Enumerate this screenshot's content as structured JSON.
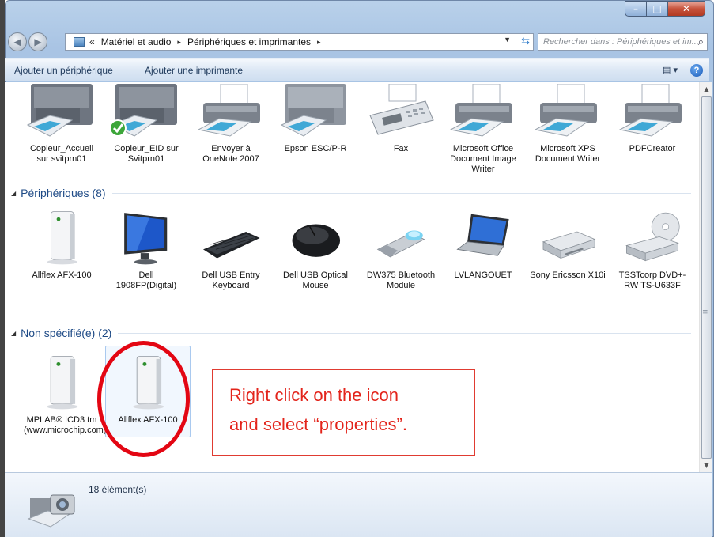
{
  "window": {
    "controls": {
      "minimize": "–",
      "maximize": "□",
      "close": "✕"
    }
  },
  "address_bar": {
    "prefix": "«",
    "breadcrumbs": [
      "Matériel et audio",
      "Périphériques et imprimantes"
    ],
    "separator": "▸",
    "search_placeholder": "Rechercher dans : Périphériques et im..."
  },
  "command_bar": {
    "add_device": "Ajouter un périphérique",
    "add_printer": "Ajouter une imprimante"
  },
  "printers_group": {
    "items": [
      {
        "label": "Copieur_Accueil sur svitprn01",
        "icon": "copier-icon"
      },
      {
        "label": "Copieur_EID sur Svitprn01",
        "icon": "copier-default-icon"
      },
      {
        "label": "Envoyer à OneNote 2007",
        "icon": "printer-icon"
      },
      {
        "label": "Epson ESC/P-R",
        "icon": "copier-icon"
      },
      {
        "label": "Fax",
        "icon": "fax-icon"
      },
      {
        "label": "Microsoft Office Document Image Writer",
        "icon": "printer-icon"
      },
      {
        "label": "Microsoft XPS Document Writer",
        "icon": "printer-icon"
      },
      {
        "label": "PDFCreator",
        "icon": "printer-icon"
      }
    ]
  },
  "devices_group": {
    "title": "Périphériques (8)",
    "items": [
      {
        "label": "Allflex AFX-100",
        "icon": "generic-device-icon"
      },
      {
        "label": "Dell 1908FP(Digital)",
        "icon": "monitor-icon"
      },
      {
        "label": "Dell USB Entry Keyboard",
        "icon": "keyboard-icon"
      },
      {
        "label": "Dell USB Optical Mouse",
        "icon": "mouse-icon"
      },
      {
        "label": "DW375 Bluetooth Module",
        "icon": "usb-bluetooth-icon"
      },
      {
        "label": "LVLANGOUET",
        "icon": "laptop-icon"
      },
      {
        "label": "Sony Ericsson X10i",
        "icon": "drive-icon"
      },
      {
        "label": "TSSTcorp DVD+-RW TS-U633F",
        "icon": "dvd-drive-icon"
      }
    ]
  },
  "unspecified_group": {
    "title": "Non spécifié(e) (2)",
    "items": [
      {
        "label": "MPLAB® ICD3 tm (www.microchip.com)",
        "icon": "generic-device-icon"
      },
      {
        "label": "Allflex AFX-100",
        "icon": "generic-device-icon",
        "selected": true
      }
    ]
  },
  "annotation": {
    "line1": "Right click on the icon",
    "line2": "and select “properties”."
  },
  "details_pane": {
    "count": "18 élément(s)"
  },
  "colors": {
    "annotation_red": "#e30613",
    "group_header": "#1e4a86"
  }
}
